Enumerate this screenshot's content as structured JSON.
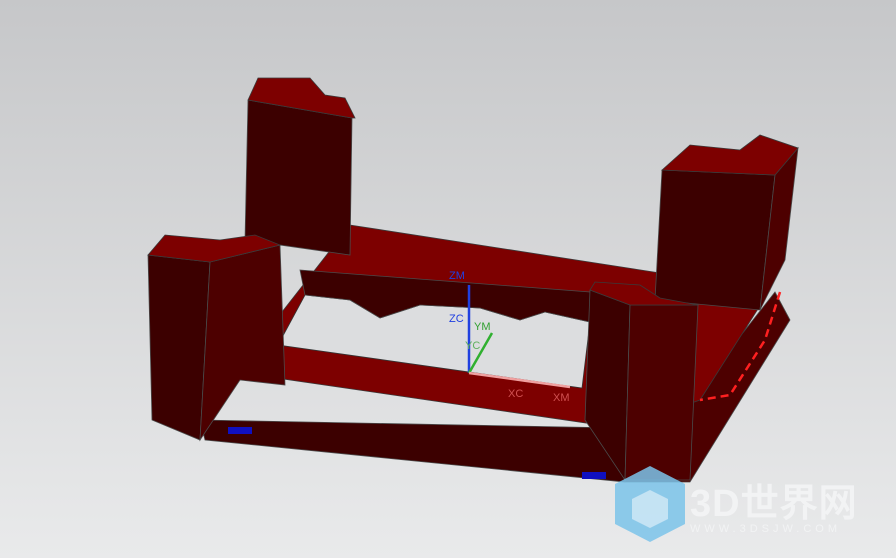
{
  "viewport": {
    "title": "3D model viewport"
  },
  "axes": {
    "zm": "ZM",
    "zc": "ZC",
    "ym": "YM",
    "yc": "YC",
    "xc": "XC",
    "xm": "XM"
  },
  "colors": {
    "part": "#7d0000",
    "part_dark": "#3c0000",
    "background": "#d8d9da",
    "selection": "#ff2020"
  },
  "watermark": {
    "title": "3D世界网",
    "url": "WWW.3DSJW.COM"
  }
}
